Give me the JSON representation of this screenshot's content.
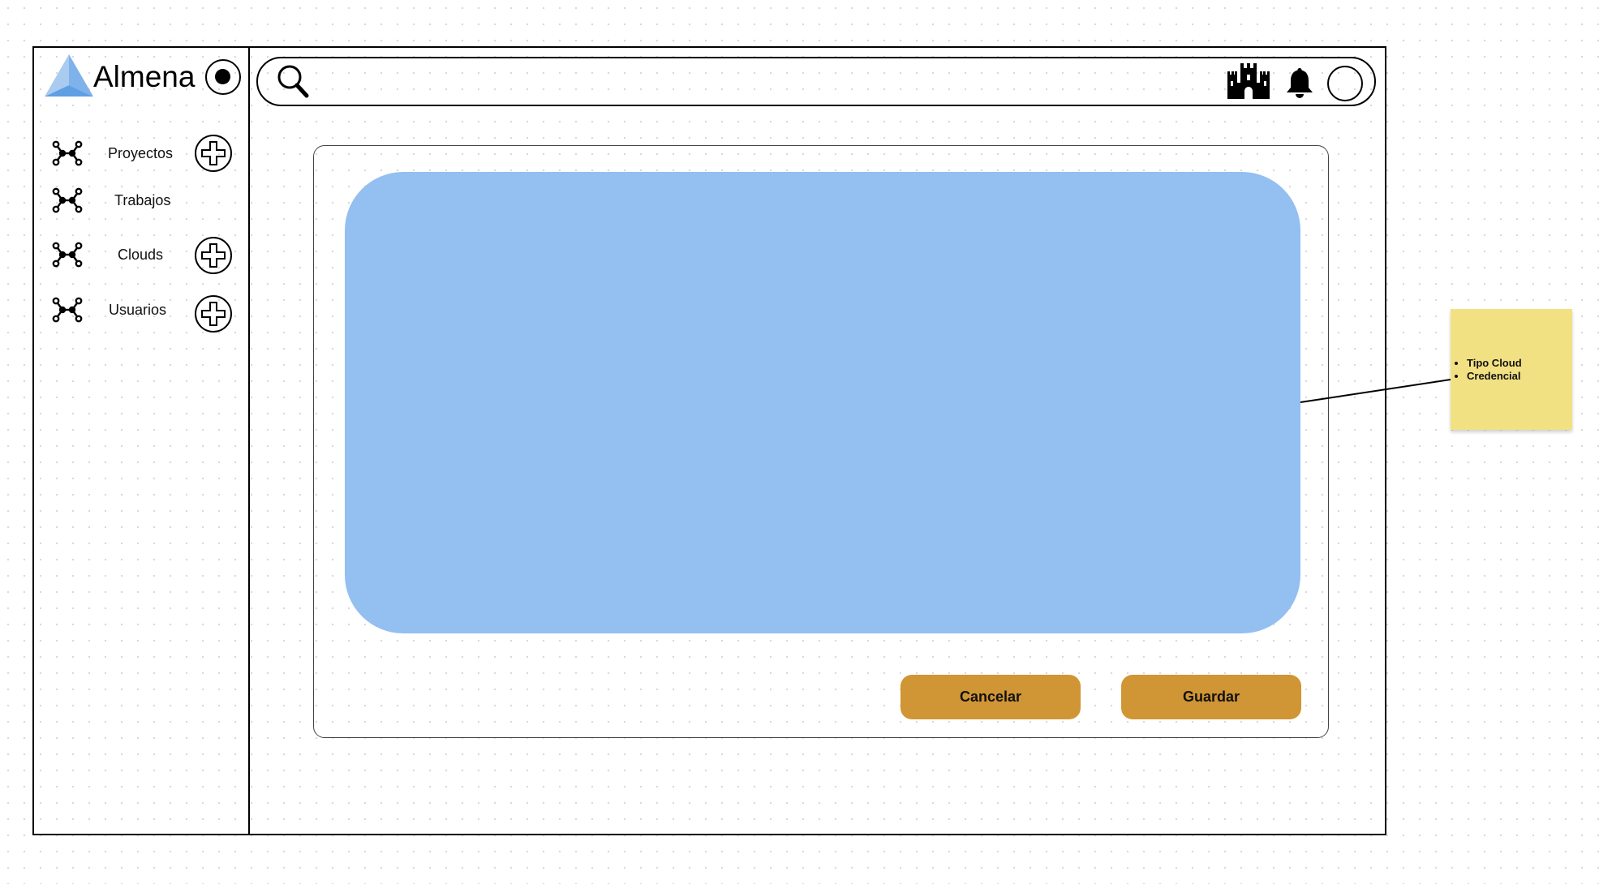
{
  "app": {
    "brand": "Almena"
  },
  "sidebar": {
    "items": [
      {
        "label": "Proyectos",
        "icon": "network-nodes-icon",
        "has_add": true
      },
      {
        "label": "Trabajos",
        "icon": "network-nodes-icon",
        "has_add": false
      },
      {
        "label": "Clouds",
        "icon": "network-nodes-icon",
        "has_add": true
      },
      {
        "label": "Usuarios",
        "icon": "network-nodes-icon",
        "has_add": true
      }
    ]
  },
  "header": {
    "search_icon": "search-icon",
    "icons": [
      "castle-icon",
      "bell-icon",
      "avatar"
    ]
  },
  "dialog": {
    "panel_color": "#93bff1",
    "cancel_label": "Cancelar",
    "save_label": "Guardar",
    "button_color": "#d09534"
  },
  "annotation": {
    "notes": [
      "Tipo Cloud",
      "Credencial"
    ],
    "color": "#f2e183"
  }
}
